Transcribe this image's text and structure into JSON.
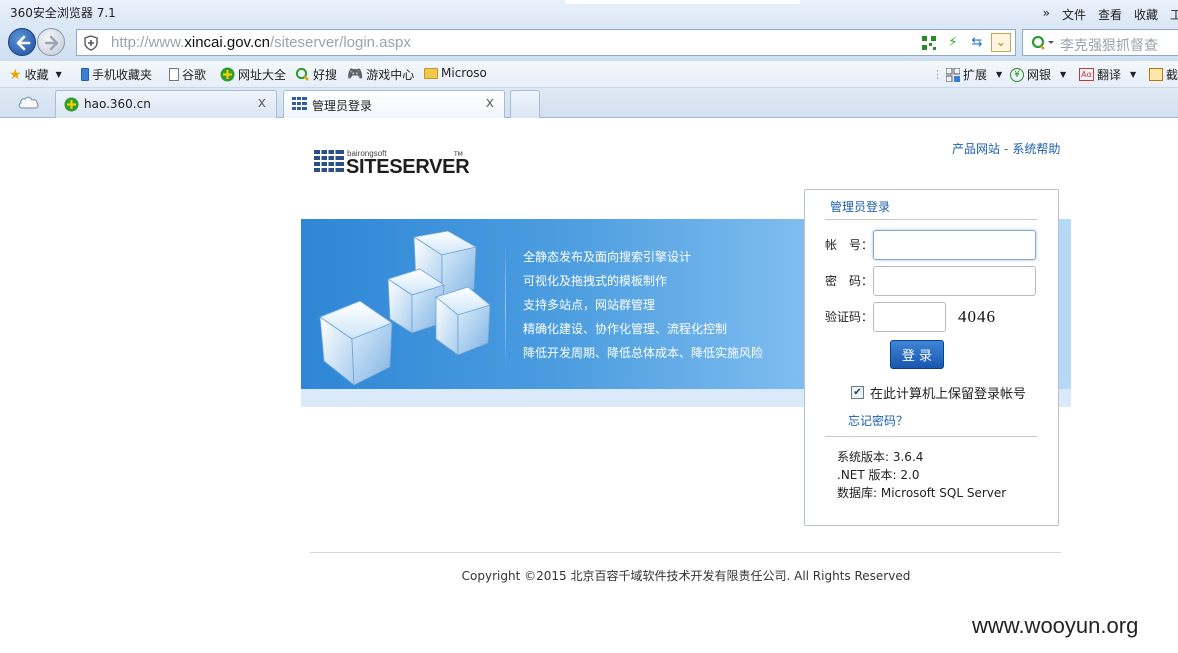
{
  "window": {
    "title": "360安全浏览器 7.1",
    "menu": [
      "»",
      "文件",
      "查看",
      "收藏",
      "工"
    ]
  },
  "address": {
    "url_prefix": "http://www.",
    "url_host": "xincai.gov.cn",
    "url_path": "/siteserver/login.aspx"
  },
  "search": {
    "placeholder": "李克强狠抓督查"
  },
  "favorites": [
    {
      "label": "收藏",
      "icon": "star-icon"
    },
    {
      "label": "手机收藏夹",
      "icon": "phone-icon"
    },
    {
      "label": "谷歌",
      "icon": "page-icon"
    },
    {
      "label": "网址大全",
      "icon": "hao360-icon"
    },
    {
      "label": "好搜",
      "icon": "haosou-icon"
    },
    {
      "label": "游戏中心",
      "icon": "gamepad-icon"
    },
    {
      "label": "Microso",
      "icon": "folder-icon"
    }
  ],
  "extensions": [
    {
      "label": "扩展",
      "icon": "grid-icon"
    },
    {
      "label": "网银",
      "icon": "bank-icon"
    },
    {
      "label": "翻译",
      "icon": "translate-icon"
    },
    {
      "label": "截",
      "icon": "screenshot-icon"
    }
  ],
  "tabs": [
    {
      "label": "hao.360.cn",
      "close": "x"
    },
    {
      "label": "管理员登录",
      "close": "x"
    }
  ],
  "page": {
    "logo_small": "bairongsoft",
    "logo_big": "SITESERVER",
    "logo_tm": "TM",
    "top_links": [
      "产品网站",
      "系统帮助"
    ],
    "top_links_sep": "-",
    "features": [
      "全静态发布及面向搜索引擎设计",
      "可视化及拖拽式的模板制作",
      "支持多站点，网站群管理",
      "精确化建设、协作化管理、流程化控制",
      "降低开发周期、降低总体成本、降低实施风险"
    ],
    "login": {
      "title": "管理员登录",
      "account_label": "帐　号：",
      "password_label": "密　码：",
      "captcha_label": "验证码：",
      "captcha_code": "4046",
      "account_value": "",
      "password_value": "",
      "captcha_value": "",
      "submit_label": "登 录",
      "remember_label": "在此计算机上保留登录帐号",
      "remember_checked": true,
      "forgot_label": "忘记密码？",
      "version": "系统版本: 3.6.4",
      "dotnet": ".NET 版本: 2.0",
      "database": "数据库: Microsoft SQL Server"
    },
    "copyright": "Copyright ©2015 北京百容千域软件技术开发有限责任公司. All Rights Reserved",
    "watermark": "www.wooyun.org"
  },
  "colors": {
    "link": "#1b5fae",
    "banner_start": "#2e86d6",
    "banner_end": "#b6daf7",
    "button": "#1a57b0"
  }
}
